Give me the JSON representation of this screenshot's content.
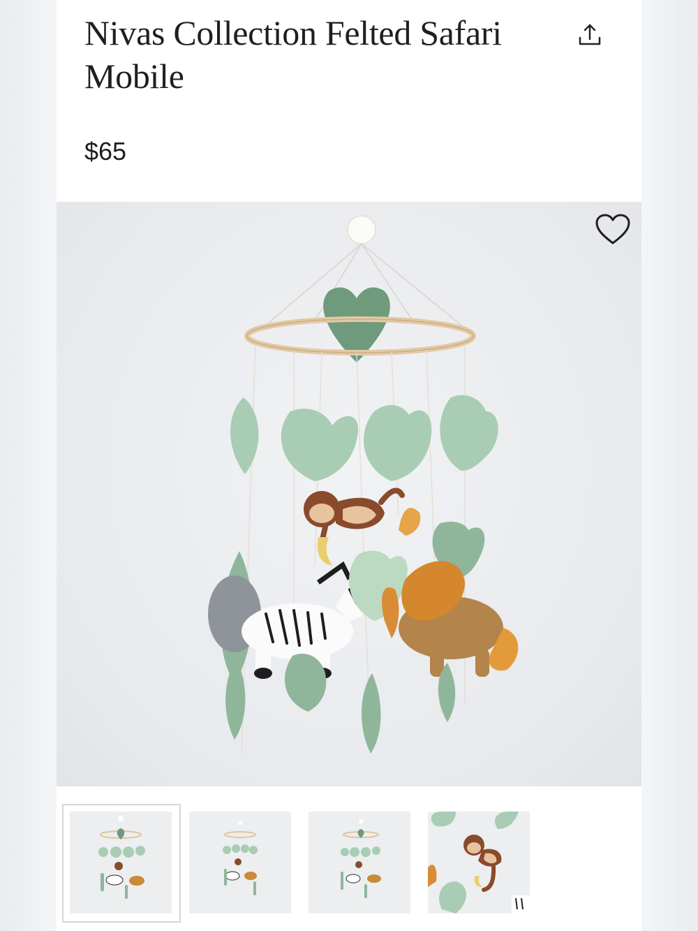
{
  "product": {
    "title": "Nivas Collection Felted Safari Mobile",
    "price": "$65"
  },
  "icons": {
    "share": "share-upload-icon",
    "favorite": "heart-outline-icon"
  },
  "gallery": {
    "thumbnails": [
      {
        "name": "thumbnail-1",
        "selected": true
      },
      {
        "name": "thumbnail-2",
        "selected": false
      },
      {
        "name": "thumbnail-3",
        "selected": false
      },
      {
        "name": "thumbnail-4",
        "selected": false
      }
    ]
  },
  "colors": {
    "leaf_light": "#a9ccb4",
    "leaf_dark": "#6f9a7c",
    "hoop": "#e3c9a3",
    "monkey": "#8a4a2c",
    "lion": "#c98a3a",
    "zebra": "#ffffff"
  }
}
